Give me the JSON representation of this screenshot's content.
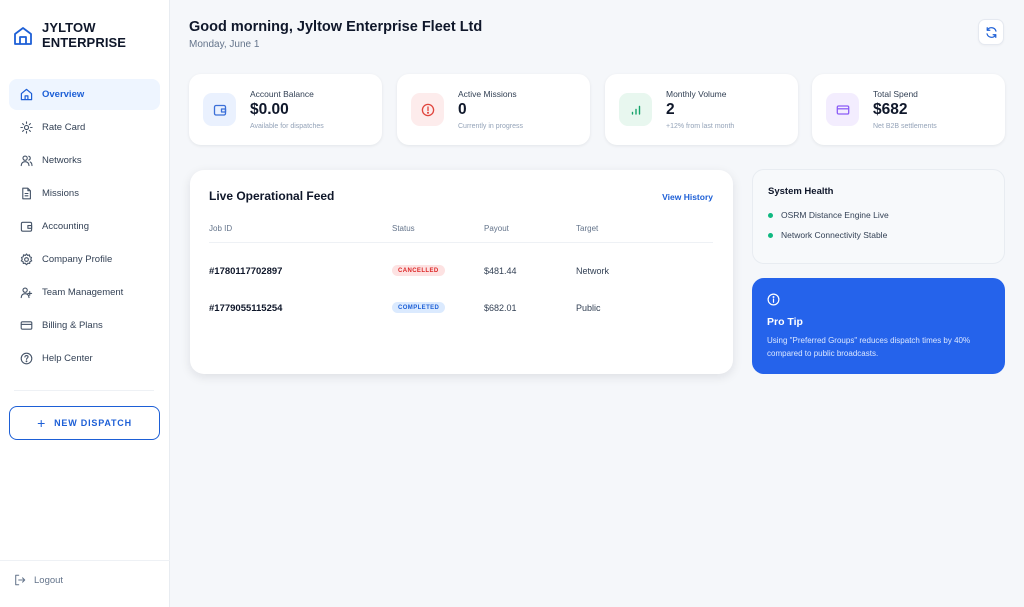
{
  "brand": {
    "line1": "JYLTOW",
    "line2": "ENTERPRISE",
    "icon": "building-icon"
  },
  "sidebar": {
    "items": [
      {
        "label": "Overview",
        "icon": "home-icon",
        "active": true
      },
      {
        "label": "Rate Card",
        "icon": "sun-icon"
      },
      {
        "label": "Networks",
        "icon": "users-icon"
      },
      {
        "label": "Missions",
        "icon": "file-icon"
      },
      {
        "label": "Accounting",
        "icon": "wallet-icon"
      },
      {
        "label": "Company Profile",
        "icon": "gear-icon"
      },
      {
        "label": "Team Management",
        "icon": "team-icon"
      },
      {
        "label": "Billing & Plans",
        "icon": "card-icon"
      },
      {
        "label": "Help Center",
        "icon": "help-icon"
      }
    ],
    "new_dispatch": "NEW DISPATCH",
    "logout": "Logout"
  },
  "header": {
    "greeting": "Good morning, Jyltow Enterprise Fleet Ltd",
    "date": "Monday, June 1"
  },
  "stats": [
    {
      "label": "Account Balance",
      "value": "$0.00",
      "sub": "Available for dispatches",
      "icon": "wallet-icon",
      "color": "#3b6fd8",
      "bg": "#eaf1fe"
    },
    {
      "label": "Active Missions",
      "value": "0",
      "sub": "Currently in progress",
      "icon": "alert-circle-icon",
      "color": "#e0443c",
      "bg": "#fdecec"
    },
    {
      "label": "Monthly Volume",
      "value": "2",
      "sub": "+12% from last month",
      "icon": "bar-chart-icon",
      "color": "#16a36a",
      "bg": "#e8f7ef"
    },
    {
      "label": "Total Spend",
      "value": "$682",
      "sub": "Net B2B settlements",
      "icon": "card-icon",
      "color": "#8b5cf6",
      "bg": "#f3edfe"
    }
  ],
  "feed": {
    "title": "Live Operational Feed",
    "view_history": "View History",
    "columns": [
      "Job ID",
      "Status",
      "Payout",
      "Target"
    ],
    "rows": [
      {
        "id": "#1780117702897",
        "status": "CANCELLED",
        "payout": "$481.44",
        "target": "Network"
      },
      {
        "id": "#1779055115254",
        "status": "COMPLETED",
        "payout": "$682.01",
        "target": "Public"
      }
    ]
  },
  "health": {
    "title": "System Health",
    "items": [
      "OSRM Distance Engine Live",
      "Network Connectivity Stable"
    ],
    "status_color": "#10b981"
  },
  "protip": {
    "title": "Pro Tip",
    "text": "Using \"Preferred Groups\" reduces dispatch times by 40% compared to public broadcasts.",
    "bg": "#2563eb"
  }
}
